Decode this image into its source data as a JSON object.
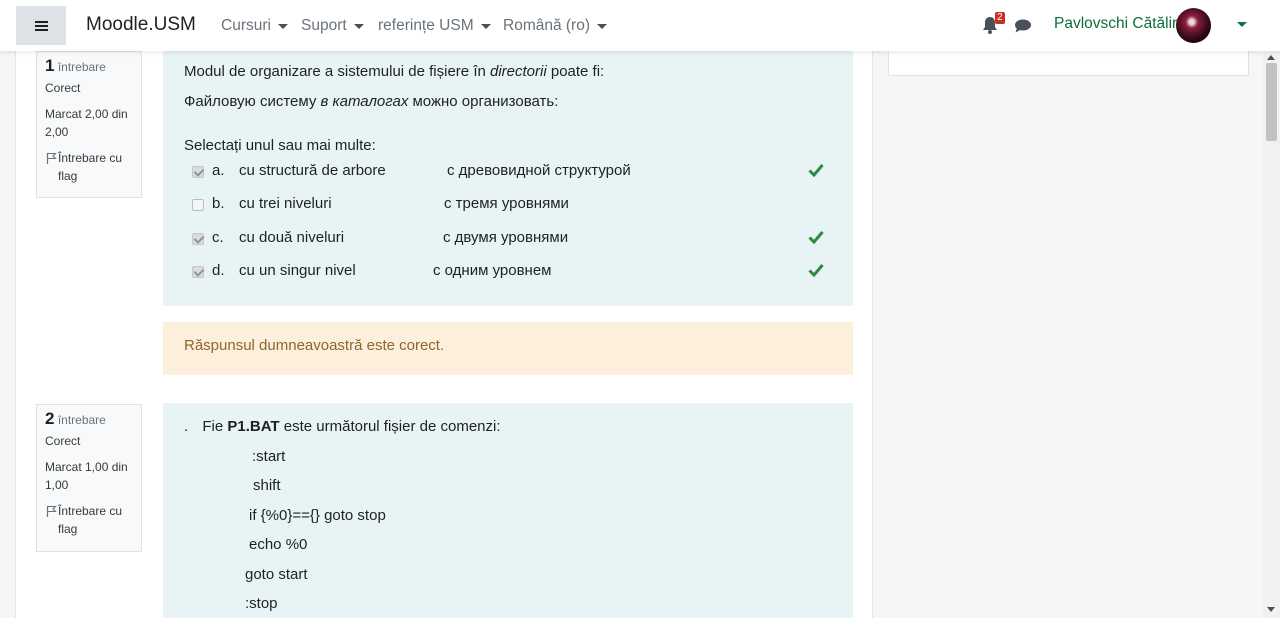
{
  "navbar": {
    "brand": "Moodle.USM",
    "menus": [
      "Cursuri",
      "Suport",
      "referințe USM",
      "Română (ro)"
    ],
    "notification_count": "2",
    "username": "Pavlovschi Cătălin"
  },
  "questions": [
    {
      "number": "1",
      "label": "întrebare",
      "state": "Corect",
      "grade": "Marcat 2,00 din 2,00",
      "flag": "Întrebare cu flag",
      "text_ro_1": "Modul de organizare a sistemului de fișiere în ",
      "text_ro_em": "directorii",
      "text_ro_2": " poate fi:",
      "text_ru_1": "Файловую систему ",
      "text_ru_em": "в каталогах",
      "text_ru_2": " можно организовать:",
      "prompt": "Selectați unul sau mai multe:",
      "options": [
        {
          "letter": "a.",
          "ro": "cu structură de arbore",
          "ru": "с древовидной структурой",
          "checked": true,
          "correct": true
        },
        {
          "letter": "b.",
          "ro": "cu trei niveluri",
          "ru": "с тремя уровнями",
          "checked": false,
          "correct": false
        },
        {
          "letter": "c.",
          "ro": "cu două niveluri",
          "ru": "с двумя уровнями",
          "checked": true,
          "correct": true
        },
        {
          "letter": "d.",
          "ro": "cu un singur nivel",
          "ru": "с одним уровнем",
          "checked": true,
          "correct": true
        }
      ],
      "feedback": "Răspunsul dumneavoastră este corect."
    },
    {
      "number": "2",
      "label": "întrebare",
      "state": "Corect",
      "grade": "Marcat 1,00 din 1,00",
      "flag": "Întrebare cu flag",
      "intro_dot": ".",
      "intro_1": "Fie ",
      "intro_bold": "P1.BAT",
      "intro_2": " este următorul fișier de comenzi:",
      "code_lines": [
        ":start",
        "shift",
        "if {%0}=={} goto stop",
        "echo %0",
        "goto start",
        ":stop"
      ]
    }
  ],
  "colors": {
    "accent_green": "#0f6e3a",
    "question_bg": "#e7f3f5",
    "feedback_bg": "#fcefdc",
    "feedback_text": "#8e662e",
    "badge": "#ca3120",
    "correct_tick": "#2f8a3e"
  },
  "icons": [
    "menu-icon",
    "bell-icon",
    "chat-icon",
    "flag-icon",
    "check-icon",
    "caret-down-icon"
  ]
}
